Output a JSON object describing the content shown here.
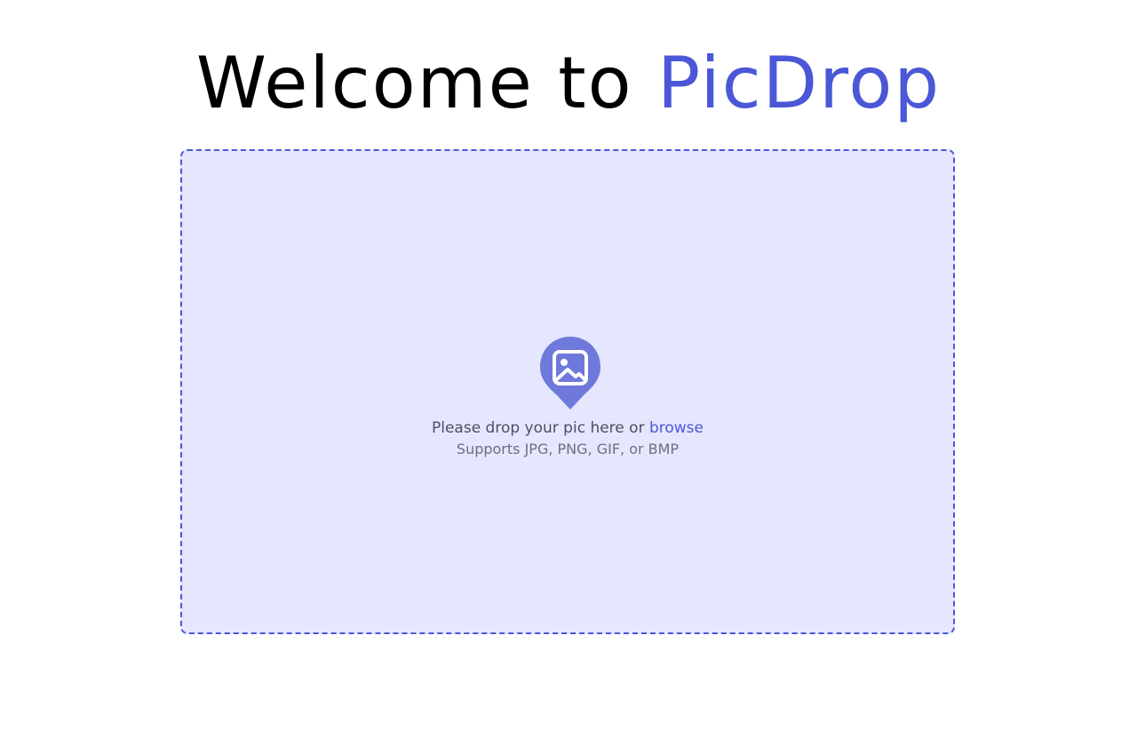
{
  "header": {
    "title_prefix": "Welcome to",
    "title_brand": "PicDrop"
  },
  "dropzone": {
    "prompt": "Please drop your pic here or",
    "browse_label": "browse",
    "supported_formats": "Supports JPG, PNG, GIF, or BMP",
    "icon": "image-pin-icon"
  },
  "colors": {
    "brand": "#4b57d6",
    "dropzone_bg": "#e4e7fd",
    "icon_fill": "#6f79db"
  }
}
